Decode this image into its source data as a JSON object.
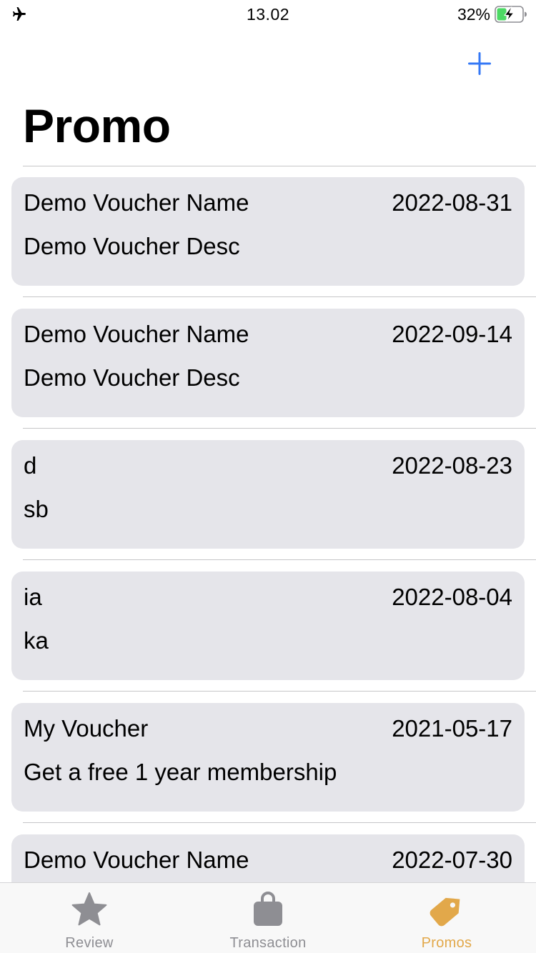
{
  "status_bar": {
    "time": "13.02",
    "battery": "32%"
  },
  "nav": {
    "add_icon": "plus-icon",
    "title": "Promo"
  },
  "vouchers": [
    {
      "name": "Demo Voucher Name",
      "date": "2022-08-31",
      "desc": "Demo Voucher Desc"
    },
    {
      "name": "Demo Voucher Name",
      "date": "2022-09-14",
      "desc": "Demo Voucher Desc"
    },
    {
      "name": "d",
      "date": "2022-08-23",
      "desc": "sb"
    },
    {
      "name": "ia",
      "date": "2022-08-04",
      "desc": "ka"
    },
    {
      "name": "My Voucher",
      "date": "2021-05-17",
      "desc": "Get a free 1 year membership"
    },
    {
      "name": "Demo Voucher Name",
      "date": "2022-07-30",
      "desc": ""
    }
  ],
  "tabs": [
    {
      "label": "Review",
      "icon": "star-icon",
      "active": false
    },
    {
      "label": "Transaction",
      "icon": "bag-icon",
      "active": false
    },
    {
      "label": "Promos",
      "icon": "tag-icon",
      "active": true
    }
  ],
  "colors": {
    "accent": "#3478f6",
    "active_tab": "#e2a84a",
    "inactive_tab": "#8e8e93",
    "card_bg": "#e5e5ea",
    "battery_fill": "#4cd964"
  }
}
